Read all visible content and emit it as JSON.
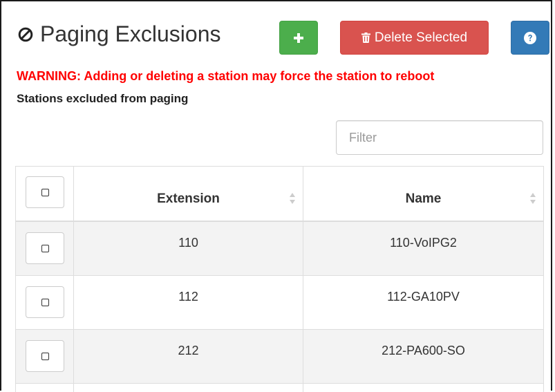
{
  "header": {
    "icon": "ban-icon",
    "title": "Paging Exclusions",
    "add_icon": "plus-icon",
    "delete_icon": "trash-icon",
    "delete_label": "Delete Selected",
    "help_icon": "question-circle-icon"
  },
  "colors": {
    "add_button": "#4cae4c",
    "delete_button": "#d9534f",
    "help_button": "#337ab7",
    "warning_text": "#ff0000"
  },
  "warning": "WARNING: Adding or deleting a station may force the station to reboot",
  "subtitle": "Stations excluded from paging",
  "filter": {
    "placeholder": "Filter",
    "value": ""
  },
  "table": {
    "columns": [
      "Extension",
      "Name"
    ],
    "rows": [
      {
        "extension": "110",
        "name": "110-VoIPG2"
      },
      {
        "extension": "112",
        "name": "112-GA10PV"
      },
      {
        "extension": "212",
        "name": "212-PA600-SO"
      }
    ]
  }
}
